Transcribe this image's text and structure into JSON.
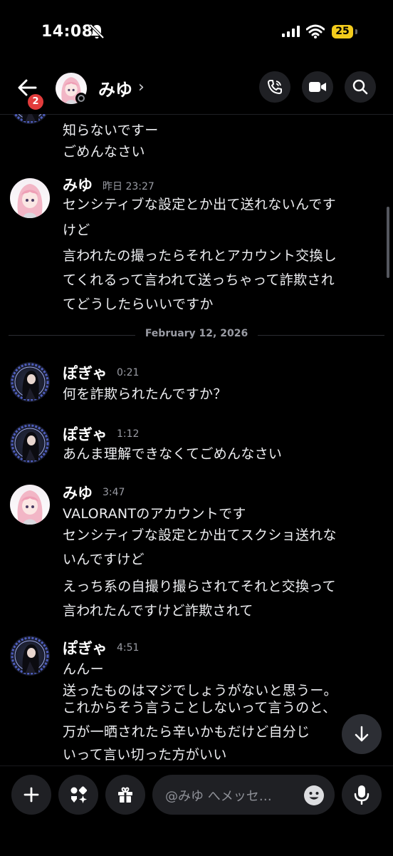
{
  "status_bar": {
    "time": "14:08",
    "battery": "25"
  },
  "header": {
    "name": "みゆ",
    "chevron": "›",
    "unread_badge": "2"
  },
  "divider": {
    "label": "February 12, 2026"
  },
  "messages": [
    {
      "lines": [
        "知らないですー",
        "ごめんなさい"
      ]
    },
    {
      "author": "みゆ",
      "time": "昨日 23:27",
      "lines": [
        "センシティブな設定とか出て送れないんです",
        "けど",
        "言われたの撮ったらそれとアカウント交換し",
        "てくれるって言われて送っちゃって詐欺され",
        "てどうしたらいいですか"
      ]
    },
    {
      "author": "ぽぎゃ",
      "time": "0:21",
      "lines": [
        "何を詐欺られたんですか？"
      ]
    },
    {
      "author": "ぽぎゃ",
      "time": "1:12",
      "lines": [
        "あんま理解できなくてごめんなさい"
      ]
    },
    {
      "author": "みゆ",
      "time": "3:47",
      "lines": [
        "VALORANTのアカウントです",
        "センシティブな設定とか出てスクショ送れな",
        "いんですけど",
        "えっち系の自撮り撮らされてそれと交換って",
        "言われたんですけど詐欺されて"
      ]
    },
    {
      "author": "ぽぎゃ",
      "time": "4:51",
      "lines": [
        "んんー",
        "送ったものはマジでしょうがないと思うー。",
        "これからそう言うことしないって言うのと、",
        "万が一晒されたら辛いかもだけど自分じ",
        "いって言い切った方がいい"
      ]
    }
  ],
  "composer": {
    "placeholder": "@みゆ へメッセ…"
  },
  "icons": {
    "back": "arrow-left-icon",
    "call": "phone-icon",
    "video": "video-icon",
    "search": "search-icon",
    "add": "plus-icon",
    "apps": "apps-icon",
    "gift": "gift-icon",
    "emoji": "emoji-icon",
    "mic": "microphone-icon",
    "jump": "arrow-down-icon"
  },
  "colors": {
    "background": "#000000",
    "badge": "#e23c3c",
    "battery": "#f4cc1c",
    "timestamp": "#9a9ca4"
  }
}
